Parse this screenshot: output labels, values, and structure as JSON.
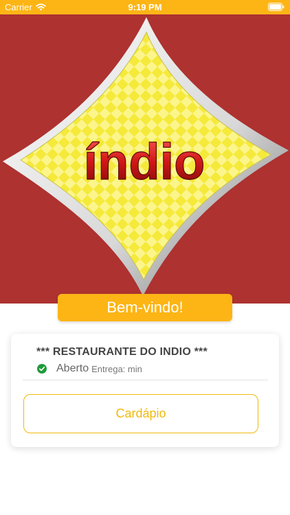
{
  "status_bar": {
    "carrier": "Carrier",
    "time": "9:19 PM"
  },
  "hero": {
    "logo_text": "índio",
    "background_color": "#ad3230",
    "logo_color": "#f5e93a"
  },
  "welcome": {
    "label": "Bem-vindo!"
  },
  "restaurant": {
    "name": "*** RESTAURANTE DO INDIO ***",
    "status": "Aberto",
    "delivery": "Entrega: min"
  },
  "menu_button": {
    "label": "Cardápio"
  },
  "colors": {
    "accent": "#fdb515",
    "button_outline": "#f0b90b",
    "status_ok": "#1f9a3a"
  },
  "icons": [
    "wifi-icon",
    "battery-icon",
    "check-circle-icon"
  ]
}
